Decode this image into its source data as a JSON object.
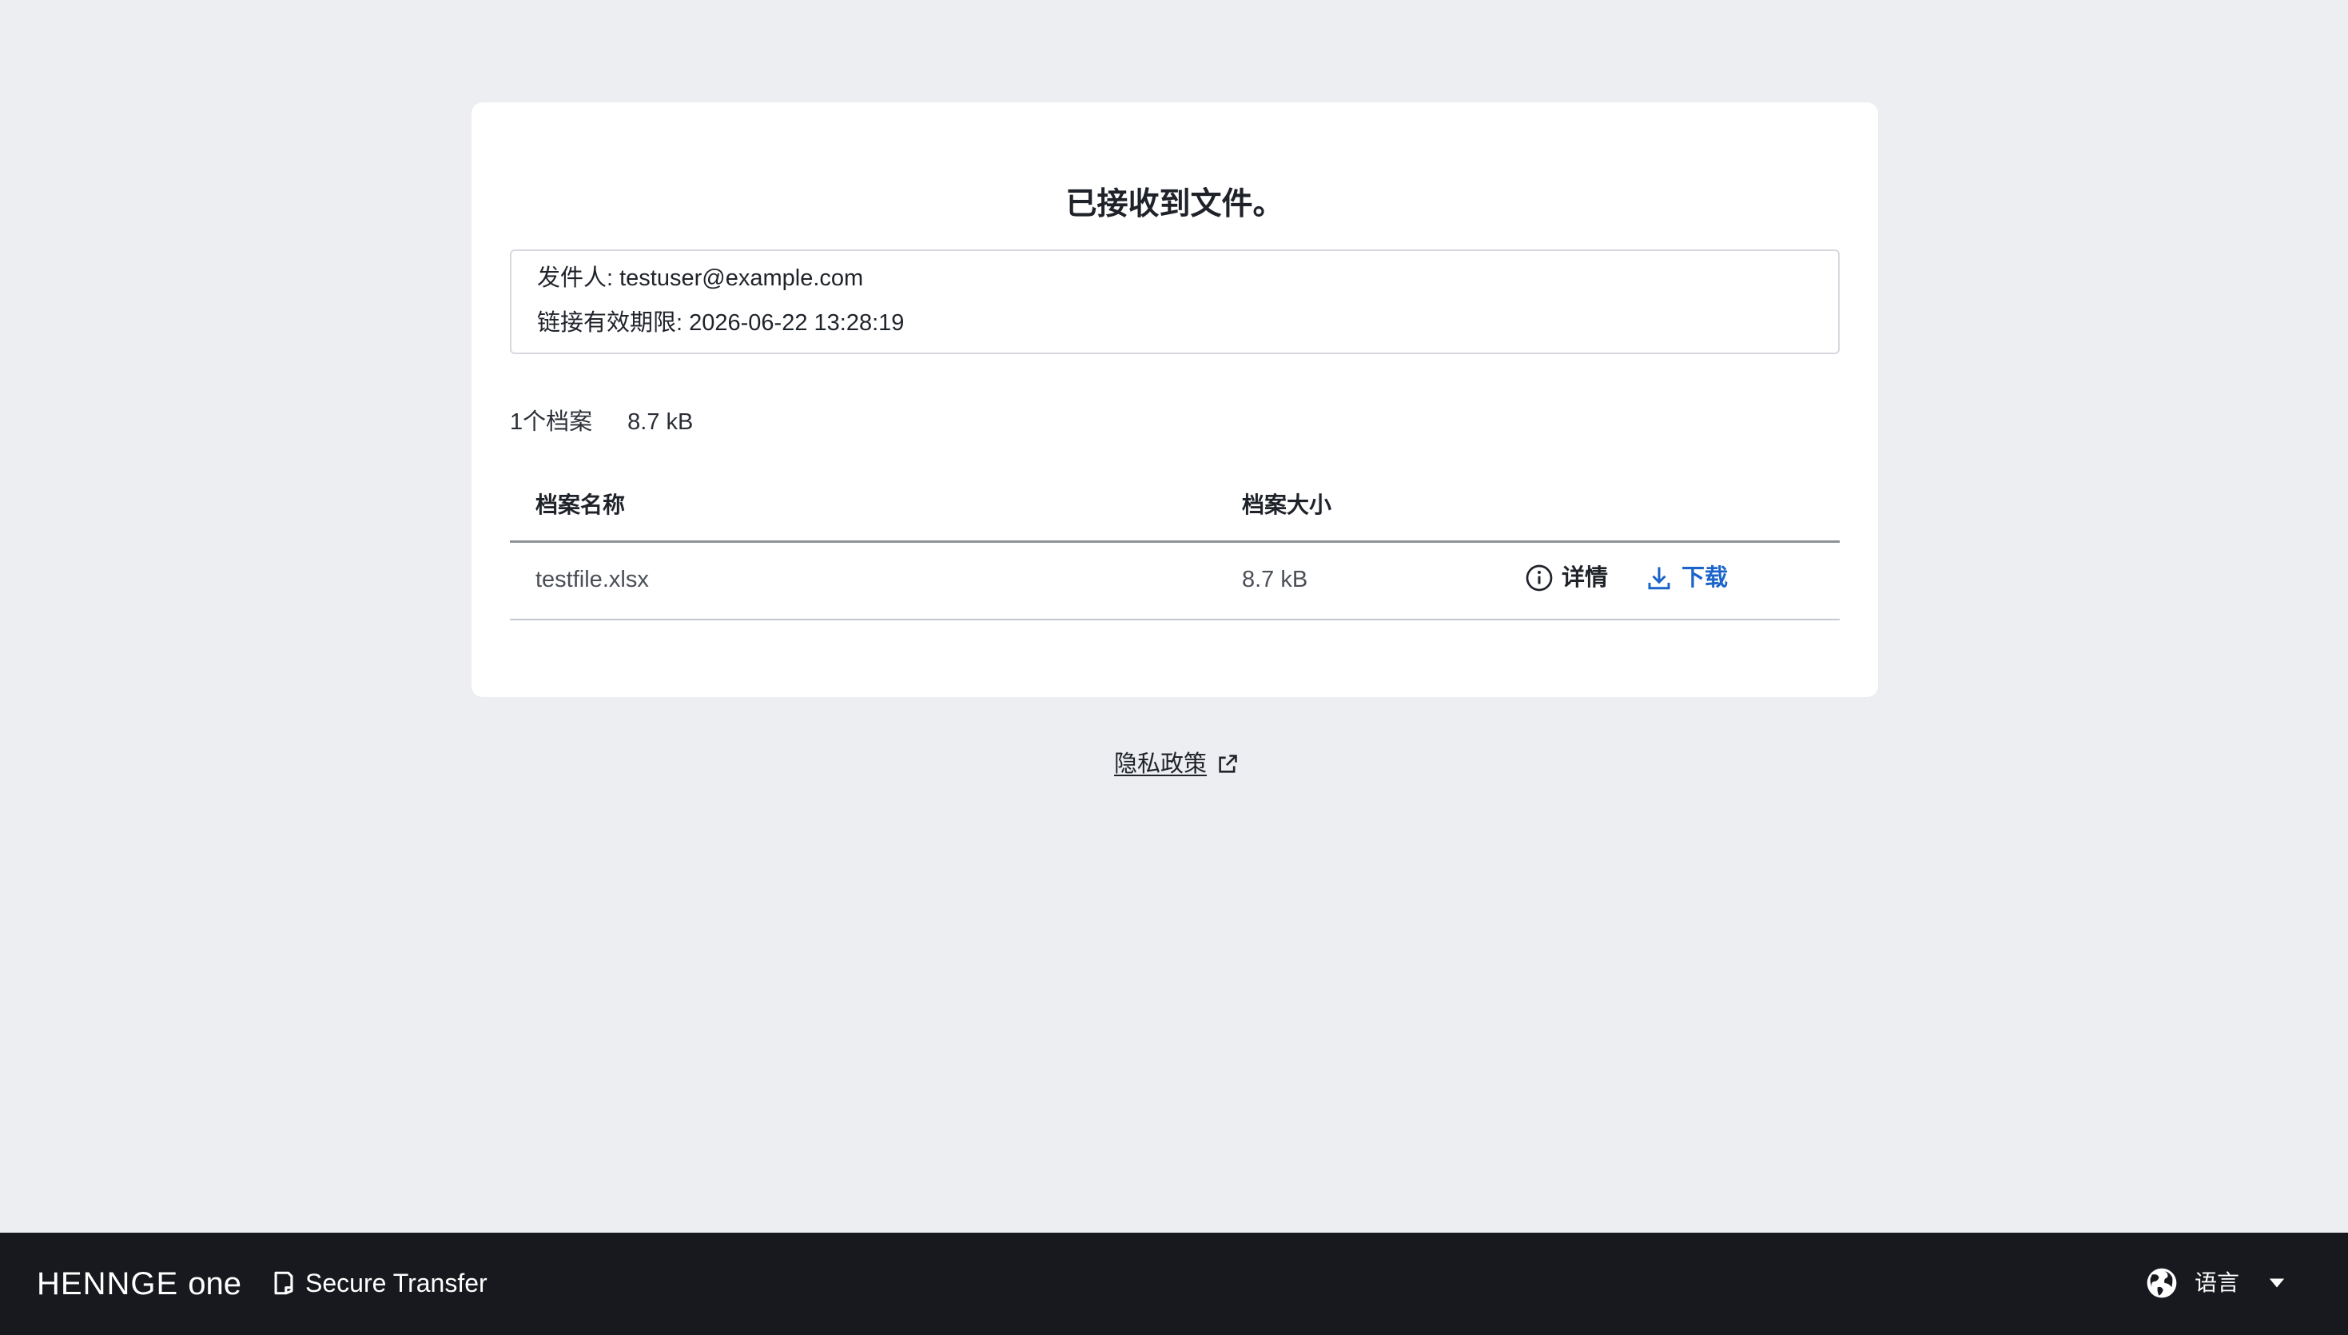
{
  "main": {
    "title": "已接收到文件。",
    "sender_label": "发件人: testuser@example.com",
    "expiry_label": "链接有效期限: 2026-06-22 13:28:19",
    "summary_count": "1个档案",
    "summary_size": "8.7 kB"
  },
  "table": {
    "headers": {
      "name": "档案名称",
      "size": "档案大小"
    },
    "rows": [
      {
        "name": "testfile.xlsx",
        "size": "8.7 kB",
        "details_label": "详情",
        "download_label": "下载"
      }
    ]
  },
  "privacy": {
    "label": "隐私政策"
  },
  "footer": {
    "brand": "HENNGE",
    "brand_suffix": "one",
    "product": "Secure Transfer",
    "language_label": "语言"
  },
  "colors": {
    "background": "#edeef2",
    "card": "#ffffff",
    "footer": "#17191e",
    "accent_link": "#1b64c9",
    "text": "#1f2329"
  },
  "icons": {
    "details": "info-circle-icon",
    "download": "download-icon",
    "privacy": "external-link-icon",
    "product": "document-icon",
    "language": "globe-icon",
    "language_menu": "caret-down-icon"
  }
}
